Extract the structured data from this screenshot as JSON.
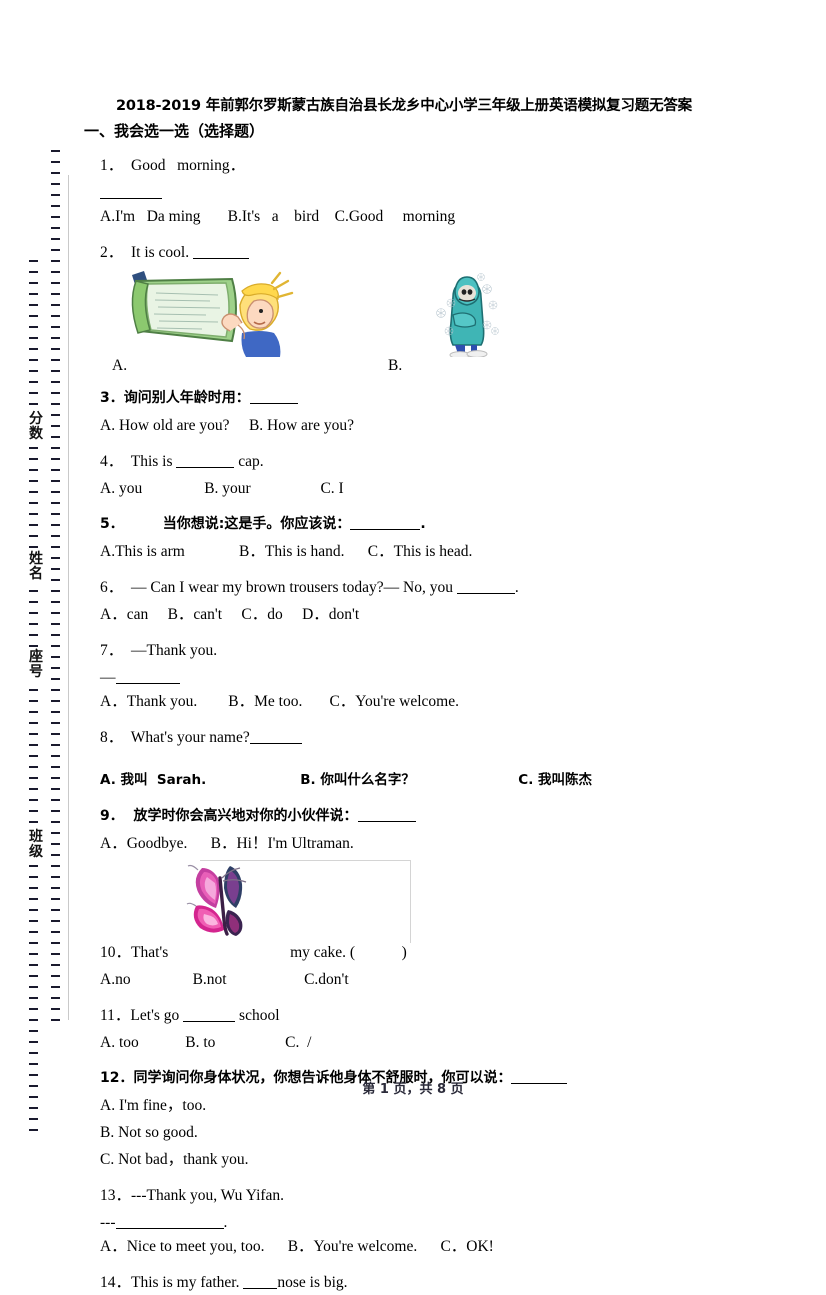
{
  "document": {
    "title": "2018-2019 年前郭尔罗斯蒙古族自治县长龙乡中心小学三年级上册英语模拟复习题无答案",
    "section_title": "一、我会选一选（选择题）",
    "footer": "第 1 页，共 8 页"
  },
  "seal_band": {
    "labels": [
      "分数",
      "姓名",
      "座号",
      "班级"
    ]
  },
  "questions": {
    "q1": {
      "stem": "1．  Good   morning．",
      "options": "A.I'm   Da ming       B.It's   a    bird    C.Good     morning"
    },
    "q2": {
      "stem": "2．  It is cool. ",
      "pic_a_label": "A.",
      "pic_b_label": "B.",
      "pic_a_name": "boy-touching-window-illustration",
      "pic_b_name": "person-shivering-in-cold-illustration"
    },
    "q3": {
      "stem": "3．询问别人年龄时用：",
      "options": "A. How old are you?     B. How are you?"
    },
    "q4": {
      "stem_before": "4．  This is ",
      "stem_after": " cap.",
      "options": "A. you                B. your                  C. I"
    },
    "q5": {
      "stem": "5．        当你想说:这是手。你应该说：",
      "stem_tail": ".",
      "options": "A.This is arm              B．This is hand.      C．This is head."
    },
    "q6": {
      "stem_before": "6．  — Can I wear my brown trousers today?— No, you ",
      "stem_after": ".",
      "options": "A．can     B．can't     C．do     D．don't"
    },
    "q7": {
      "stem": "7．  —Thank you.",
      "lead": "—",
      "options": "A．Thank you.        B．Me too.       C．You're welcome."
    },
    "q8": {
      "stem": "8．  What's your name?",
      "options": "A. 我叫  Sarah.                    B. 你叫什么名字？                      C. 我叫陈杰"
    },
    "q9": {
      "stem": "9．  放学时你会高兴地对你的小伙伴说：",
      "options": "A．Goodbye.      B．Hi！I'm Ultraman."
    },
    "q10": {
      "stem_before": "10．That's ",
      "stem_after": "my cake. (            )",
      "options": "A.no                B.not                    C.don't",
      "pic_name": "butterfly-illustration"
    },
    "q11": {
      "stem_before": "11．Let's go ",
      "stem_after": " school",
      "options": "A. too            B. to                  C.  /"
    },
    "q12": {
      "stem": "12．同学询问你身体状况，你想告诉他身体不舒服时，你可以说：",
      "option_a": "A. I'm fine，too.",
      "option_b": "B. Not so good.",
      "option_c": "C. Not bad，thank you."
    },
    "q13": {
      "stem": "13．---Thank you, Wu Yifan.",
      "lead": "---",
      "lead_tail": ".",
      "options": "A．Nice to meet you, too.      B．You're welcome.      C．OK!"
    },
    "q14": {
      "stem_before": "14．This is my father. ",
      "stem_after": "nose is big."
    }
  },
  "colors": {
    "text": "#000000",
    "divider": "#c9c9c9",
    "footer": "#2b2b3a",
    "window_green": "#8fbf7a",
    "coat_teal": "#3fb5b5",
    "butterfly_pink": "#d4258f"
  }
}
